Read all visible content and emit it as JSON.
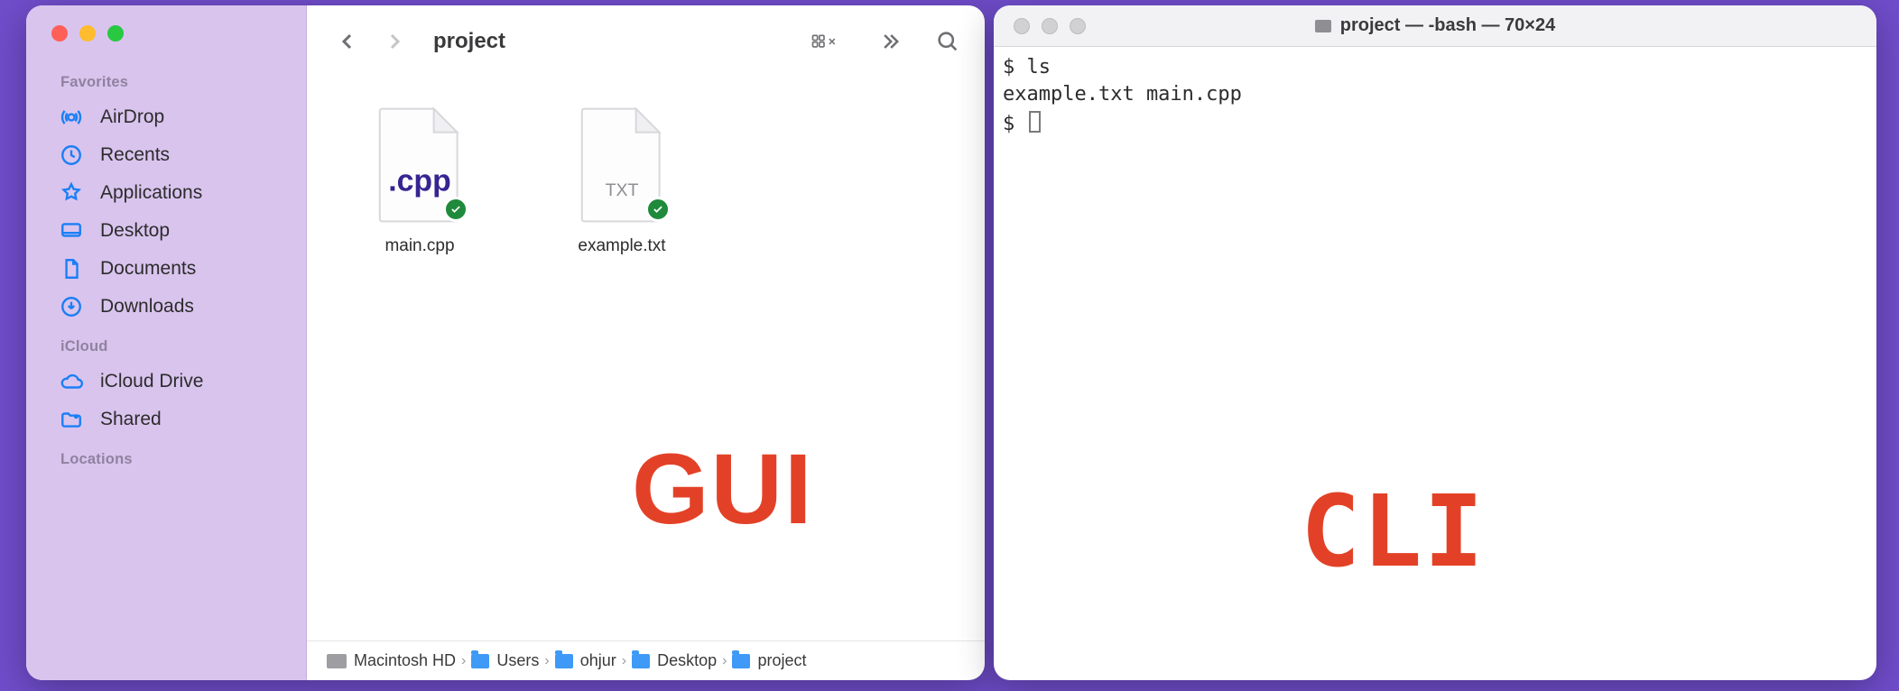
{
  "finder": {
    "title": "project",
    "overlay": "GUI",
    "sidebar": {
      "favorites_label": "Favorites",
      "icloud_label": "iCloud",
      "locations_label": "Locations",
      "items_fav": [
        {
          "label": "AirDrop"
        },
        {
          "label": "Recents"
        },
        {
          "label": "Applications"
        },
        {
          "label": "Desktop"
        },
        {
          "label": "Documents"
        },
        {
          "label": "Downloads"
        }
      ],
      "items_icloud": [
        {
          "label": "iCloud Drive"
        },
        {
          "label": "Shared"
        }
      ]
    },
    "files": [
      {
        "name": "main.cpp",
        "ext": ".cpp"
      },
      {
        "name": "example.txt",
        "ext": "TXT"
      }
    ],
    "path": [
      "Macintosh HD",
      "Users",
      "ohjur",
      "Desktop",
      "project"
    ]
  },
  "terminal": {
    "title": "project — -bash — 70×24",
    "overlay": "CLI",
    "lines": {
      "l1": "$ ls",
      "l2": "example.txt main.cpp",
      "l3": "$ "
    }
  }
}
